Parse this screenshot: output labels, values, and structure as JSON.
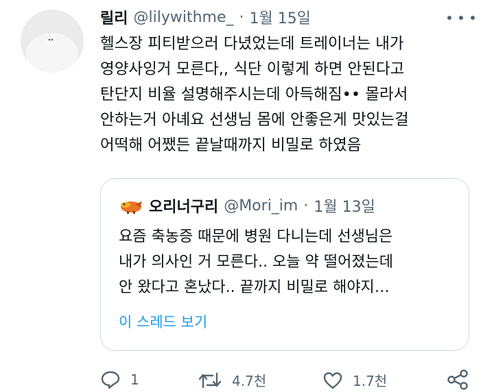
{
  "tweet": {
    "author_name": "릴리",
    "handle": "@lilywithme_",
    "separator": "·",
    "date": "1월 15일",
    "text_lines": [
      "헬스장 피티받으러 다녔었는데 트레이너는 내가",
      "영양사잉거 모른다,, 식단 이렇게 하면 안된다고",
      "탄단지 비율 설명해주시는데 아득해짐•• 몰라서",
      "안하는거 아녜요 선생님 몸에 안좋은게 맛있는걸",
      "어떡해 어쨌든 끝날때까지 비밀로 하였음"
    ]
  },
  "quote": {
    "author_name": "오리너구리",
    "handle": "@Mori_im",
    "separator": "·",
    "date": "1월 13일",
    "text_lines": [
      "요즘 축농증 때문에 병원 다니는데 선생님은",
      "내가 의사인 거 모른다.. 오늘 약 떨어졌는데",
      "안 왔다고 혼났다.. 끝까지 비밀로 해야지…"
    ],
    "show_thread_label": "이 스레드 보기"
  },
  "actions": {
    "reply_count": "1",
    "retweet_count": "4.7천",
    "like_count": "1.7천"
  },
  "colors": {
    "text": "#0f1419",
    "secondary": "#536471",
    "link": "#1d9bf0",
    "border": "#cfd9de"
  },
  "icons": [
    "more-icon",
    "reply-icon",
    "retweet-icon",
    "like-icon",
    "share-icon"
  ]
}
